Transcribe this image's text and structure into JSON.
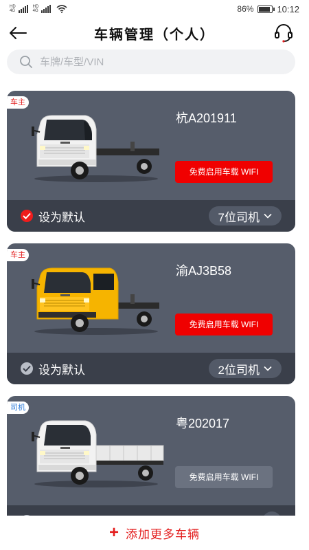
{
  "status_bar": {
    "sim1": "HD",
    "sim2": "HD",
    "net1": "4G",
    "net2": "4G",
    "battery_text": "86%",
    "battery_level": 0.86,
    "time": "10:12",
    "icons": [
      "signal-icon",
      "wifi-icon",
      "battery-icon"
    ]
  },
  "header": {
    "title": "车辆管理（个人）",
    "back_icon": "back-arrow-icon",
    "service_icon": "customer-service-headset-icon"
  },
  "search": {
    "placeholder": "车牌/车型/VIN",
    "icon": "search-icon"
  },
  "vehicles": [
    {
      "role": "车主",
      "plate": "杭A201911",
      "wifi_label": "免费启用车载 WIFI",
      "wifi_color": "#f00000",
      "default_label": "设为默认",
      "is_default": true,
      "drivers_label": "7位司机",
      "truck_color": "#f2f2f2"
    },
    {
      "role": "车主",
      "plate": "渝AJ3B58",
      "wifi_label": "免费启用车载 WIFI",
      "wifi_color": "#f00000",
      "default_label": "设为默认",
      "is_default": false,
      "drivers_label": "2位司机",
      "truck_color": "#f6b400"
    },
    {
      "role": "司机",
      "plate": "粤202017",
      "wifi_label": "免费启用车载 WIFI",
      "wifi_color": "#6b7280",
      "default_label": "",
      "is_default": false,
      "drivers_label": "",
      "truck_color": "#f2f2f2"
    }
  ],
  "colors": {
    "accent": "#e31c1c",
    "card": "#565d6b",
    "card_bottom": "#3a3f4a"
  },
  "footer": {
    "plus_icon": "+",
    "add_label": "添加更多车辆"
  }
}
